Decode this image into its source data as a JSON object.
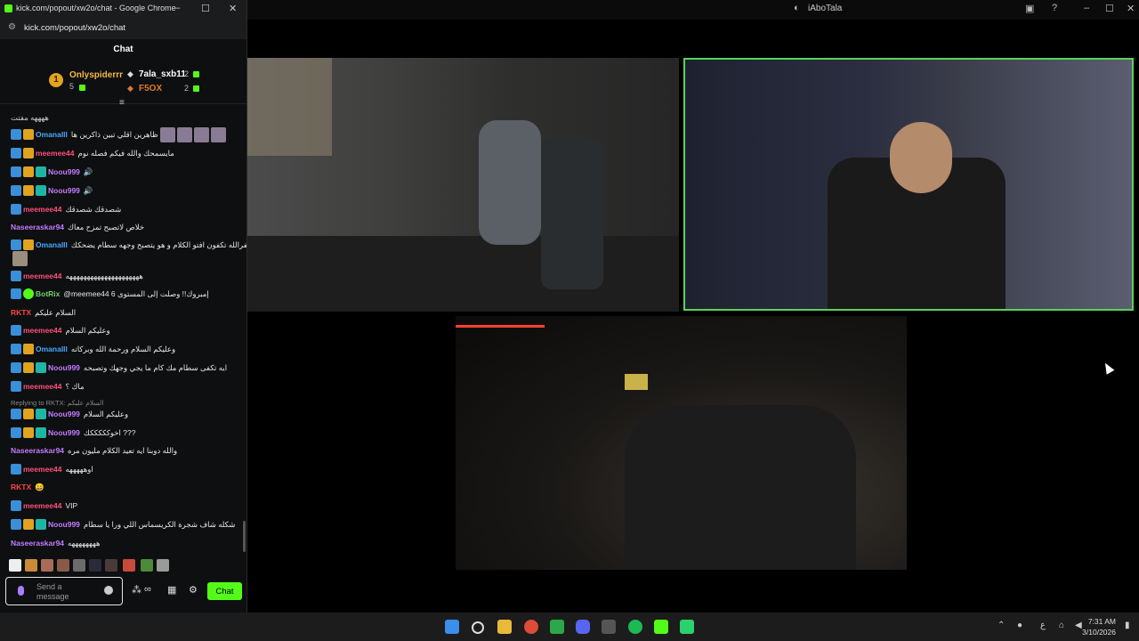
{
  "window": {
    "title": "kick.com/popout/xw2o/chat - Google Chrome",
    "url": "kick.com/popout/xw2o/chat"
  },
  "desktop_app": {
    "title": "iAboTala"
  },
  "chat": {
    "heading": "Chat",
    "leaderboard": [
      {
        "rank": "1",
        "name": "Onlyspiderrr",
        "count": "5"
      },
      {
        "name": "7ala_sxb11",
        "count": "2"
      },
      {
        "name": "F5OX",
        "count": "2"
      }
    ],
    "pinned_fragment": "ههههه مفتت",
    "messages": [
      {
        "user": "Omanalll",
        "text": "ظاهرين اقلي تبين ذاكرين ها"
      },
      {
        "user": "meemee44",
        "text": "مايسمحك والله فيكم فصله نوم"
      },
      {
        "user": "Noou999",
        "text": ""
      },
      {
        "user": "Noou999",
        "text": ""
      },
      {
        "user": "meemee44",
        "text": "شصدقك شصدقك"
      },
      {
        "user": "Naseeraskar94",
        "text": "خلاص لاتصبح تمزح معاك"
      },
      {
        "user": "Omanalll",
        "text": "استغفرالله تكفون افتو الكلام و هو يتصبح وجهه سطام يضحكك"
      },
      {
        "user": "meemee44",
        "text": "هههههههههههههههههههههه"
      },
      {
        "user": "BotRix",
        "text": "@meemee44 إمبروك!! وصلت إلى المستوى 6"
      },
      {
        "user": "RKTX",
        "text": "السلام عليكم"
      },
      {
        "user": "meemee44",
        "text": "وعليكم السلام"
      },
      {
        "user": "Omanalll",
        "text": "وعليكم السلام ورحمة الله وبركاته"
      },
      {
        "user": "Noou999",
        "text": "ايه تكفى سطام مك كام ما يجي وجهك وتصبحه"
      },
      {
        "user": "meemee44",
        "text": "ماك ؟"
      },
      {
        "user": "Noou999",
        "text": "وعليكم السلام",
        "reply_to": "Replying to RKTX: السلام عليكم"
      },
      {
        "user": "Noou999",
        "text": "اخوكككككك ???"
      },
      {
        "user": "Naseeraskar94",
        "text": "والله دوبنا ايه تعيد الكلام مليون مره"
      },
      {
        "user": "meemee44",
        "text": "اوهههههه"
      },
      {
        "user": "RKTX",
        "text": "😄"
      },
      {
        "user": "meemee44",
        "text": "VIP"
      },
      {
        "user": "Noou999",
        "text": "شكله شاف شجرة الكريسماس اللي ورا يا سطام"
      },
      {
        "user": "Naseeraskar94",
        "text": "ههههههههه"
      }
    ],
    "input_placeholder": "Send a message",
    "infinity_label": "∞",
    "send_label": "Chat"
  },
  "taskbar": {
    "time": "7:31 AM",
    "date": "3/10/2026",
    "lang": "ع"
  },
  "colors": {
    "kick_green": "#53fc18",
    "taskbar_bg": "#1c1c1c",
    "chat_bg": "#0e0f10"
  }
}
